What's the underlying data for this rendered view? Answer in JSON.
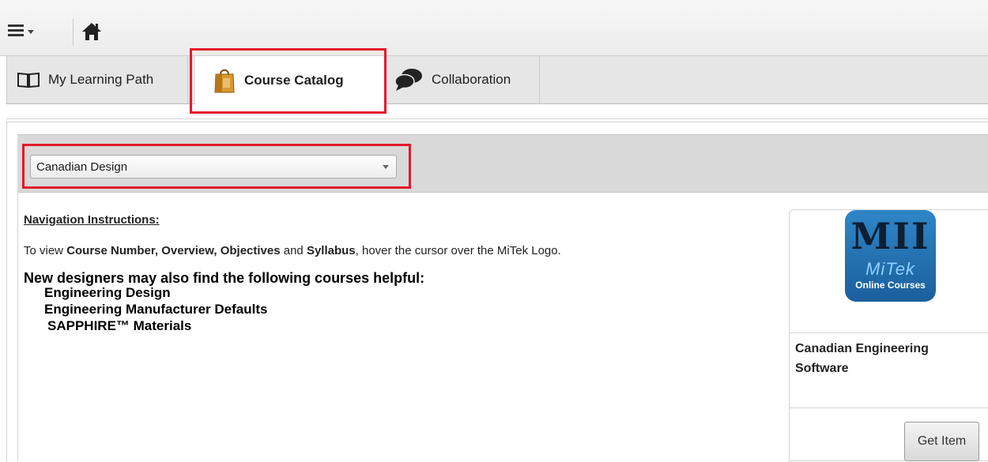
{
  "toolbar": {
    "menu_icon": "hamburger-menu-icon",
    "home_icon": "home-icon"
  },
  "tabs": [
    {
      "label": "My Learning Path",
      "icon": "open-book-icon",
      "selected": false
    },
    {
      "label": "Course Catalog",
      "icon": "shopping-bag-icon",
      "selected": true
    },
    {
      "label": "Collaboration",
      "icon": "speech-bubbles-icon",
      "selected": false
    }
  ],
  "filter": {
    "selected": "Canadian Design"
  },
  "content": {
    "nav_heading": "Navigation Instructions:",
    "instr_prefix": "To view ",
    "instr_terms": "Course Number, Overview, Objectives",
    "instr_and": " and ",
    "instr_syllabus": "Syllabus",
    "instr_suffix": ", hover the cursor over the MiTek Logo.",
    "helpful_heading": "New designers may also find the following courses helpful:",
    "courses": [
      "Engineering Design",
      "Engineering Manufacturer Defaults",
      "SAPPHIRE™ Materials"
    ]
  },
  "card": {
    "logo_text_top": "MII",
    "logo_text_brand": "MiTek",
    "logo_text_sub": "Online Courses",
    "title": "Canadian Engineering Software",
    "button_label": "Get Item"
  },
  "colors": {
    "highlight": "#e3192b",
    "logo_blue": "#2f86c8"
  }
}
